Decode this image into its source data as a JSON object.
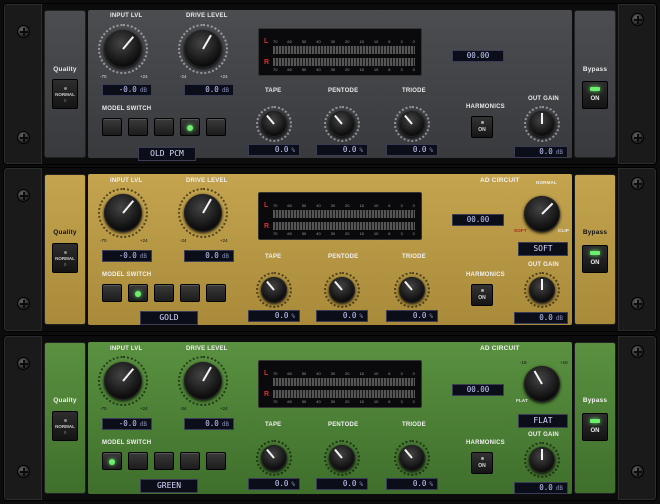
{
  "labels": {
    "input_lvl": "INPUT LVL",
    "drive_level": "DRIVE LEVEL",
    "tape": "TAPE",
    "pentode": "PENTODE",
    "triode": "TRIODE",
    "harmonics": "HARMONICS",
    "out_gain": "OUT GAIN",
    "model_switch": "MODEL SWITCH",
    "quality": "Quality",
    "bypass": "Bypass",
    "ad_circuit": "AD CIRCUIT",
    "normal": "NORMAL",
    "soft": "SOFT",
    "clip": "CLIP",
    "flat": "FLAT"
  },
  "units": {
    "db": "dB",
    "pct": "%"
  },
  "ticks": {
    "in_min": "-70",
    "in_max": "+24",
    "dr_min": "-24",
    "dr_max": "+24",
    "ad_min": "-18",
    "ad_max": "+18"
  },
  "meter": {
    "left": "L",
    "right": "R",
    "scale": [
      "70",
      "60",
      "50",
      "40",
      "30",
      "20",
      "15",
      "10",
      "6",
      "3",
      "0"
    ]
  },
  "buttons": {
    "quality_value": "NORMAL",
    "on": "ON"
  },
  "unit1": {
    "input": "-0.0",
    "drive": "0.0",
    "tape": "0.0",
    "pentode": "0.0",
    "triode": "0.0",
    "out": "0.0",
    "peak": "00.00",
    "model": "OLD PCM",
    "model_led": 3
  },
  "unit2": {
    "input": "-0.0",
    "drive": "0.0",
    "tape": "0.0",
    "pentode": "0.0",
    "triode": "0.0",
    "out": "0.0",
    "peak": "00.00",
    "model": "GOLD",
    "model_led": 1,
    "ad_mode": "SOFT"
  },
  "unit3": {
    "input": "-0.0",
    "drive": "0.0",
    "tape": "0.0",
    "pentode": "0.0",
    "triode": "0.0",
    "out": "0.0",
    "peak": "00.00",
    "model": "GREEN",
    "model_led": 0,
    "ad_mode": "FLAT"
  },
  "colors": {
    "accent_led": "#6cf06c",
    "readout_bg": "#0b0d18",
    "readout_text": "#c8d0ff"
  }
}
